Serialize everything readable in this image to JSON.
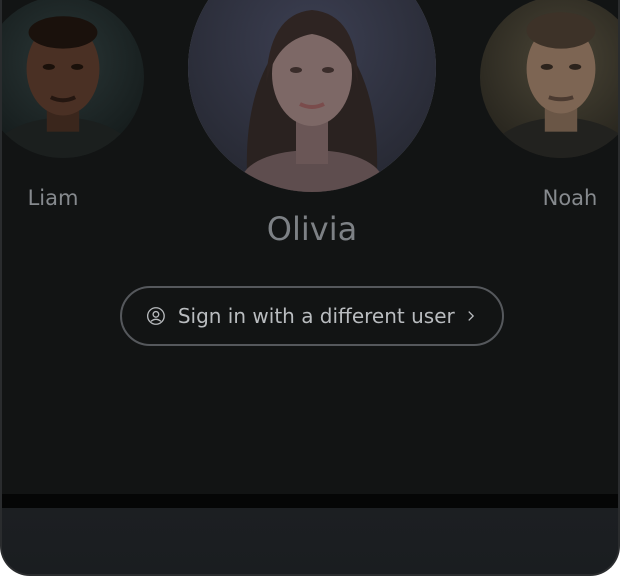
{
  "users": {
    "left": {
      "name": "Liam"
    },
    "center": {
      "name": "Olivia"
    },
    "right": {
      "name": "Noah"
    }
  },
  "signin_button": {
    "label": "Sign in with a different user",
    "icon": "user-circle-icon",
    "chevron_icon": "chevron-right-icon"
  },
  "colors": {
    "background": "#121414",
    "text_muted": "#868a8e",
    "button_border": "#55585c",
    "bottom_bar": "#1c1f22"
  }
}
